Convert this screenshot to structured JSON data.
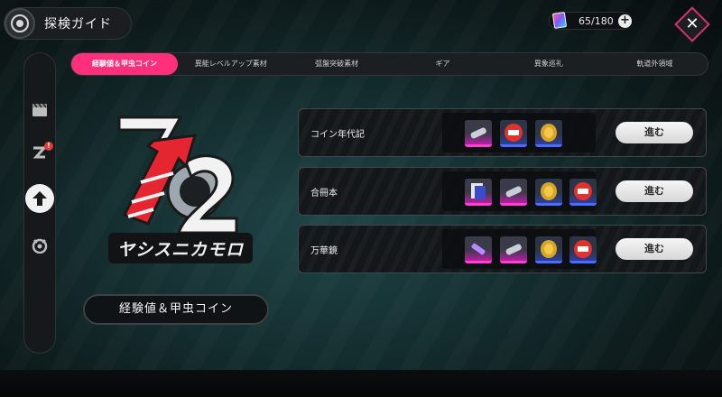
{
  "header": {
    "title": "探検ガイド",
    "stamina": "65/180"
  },
  "tabs": [
    {
      "label": "経験値＆甲虫コイン",
      "active": true
    },
    {
      "label": "異能レベルアップ素材",
      "active": false
    },
    {
      "label": "弧盤突破素材",
      "active": false
    },
    {
      "label": "ギア",
      "active": false
    },
    {
      "label": "異象巡礼",
      "active": false
    },
    {
      "label": "軌道外領域",
      "active": false
    }
  ],
  "sidebar": [
    {
      "icon": "clapperboard-icon",
      "active": false,
      "alert": false
    },
    {
      "icon": "z-emblem-icon",
      "active": false,
      "alert": true
    },
    {
      "icon": "upgrade-arrow-icon",
      "active": true,
      "alert": false
    },
    {
      "icon": "shield-emblem-icon",
      "active": false,
      "alert": false
    }
  ],
  "sidebar_badge": "!",
  "category": {
    "label": "経験値＆甲虫コイン",
    "logo_text": "ヤシスニカモロ"
  },
  "stages": [
    {
      "name": "コイン年代記",
      "rewards": [
        "purple-cylinder-icon",
        "red-chip-icon",
        "gold-coin-icon"
      ],
      "button": "進む"
    },
    {
      "name": "合冊本",
      "rewards": [
        "card-deck-icon",
        "purple-cylinder-icon",
        "gold-coin-icon",
        "red-chip-icon"
      ],
      "button": "進む"
    },
    {
      "name": "万華鏡",
      "rewards": [
        "purple-syringe-icon",
        "purple-cylinder-icon",
        "gold-coin-icon",
        "red-chip-icon"
      ],
      "button": "進む"
    }
  ],
  "colors": {
    "accent_pink": "#ff2f7c",
    "rarity_purple": "#ff3fd0",
    "rarity_blue": "#4d6cff",
    "logo_red": "#e5252f"
  }
}
